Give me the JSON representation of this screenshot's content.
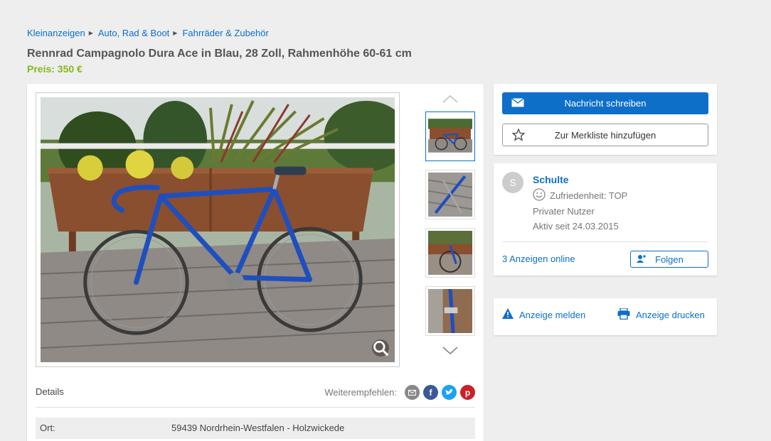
{
  "breadcrumb": {
    "items": [
      "Kleinanzeigen",
      "Auto, Rad & Boot",
      "Fahrräder & Zubehör"
    ]
  },
  "ad": {
    "title": "Rennrad Campagnolo Dura Ace in Blau, 28 Zoll, Rahmenhöhe 60-61 cm",
    "price": "Preis: 350 €"
  },
  "gallery": {
    "thumbnails": 4,
    "selected_index": 0
  },
  "details": {
    "label": "Details",
    "share_label": "Weiterempfehlen:",
    "location_key": "Ort:",
    "location_value": "59439 Nordrhein-Westfalen - Holzwickede"
  },
  "contact": {
    "message_button": "Nachricht schreiben",
    "watchlist_button": "Zur Merkliste hinzufügen"
  },
  "seller": {
    "avatar_letter": "S",
    "name": "Schulte",
    "rating": "Zufriedenheit: TOP",
    "type": "Privater Nutzer",
    "since": "Aktiv seit 24.03.2015",
    "ads_online": "3 Anzeigen online",
    "follow_button": "Folgen"
  },
  "actions": {
    "report": "Anzeige melden",
    "print": "Anzeige drucken"
  },
  "colors": {
    "accent": "#0e6fc9",
    "price": "#86b817",
    "background": "#eeeeee"
  }
}
